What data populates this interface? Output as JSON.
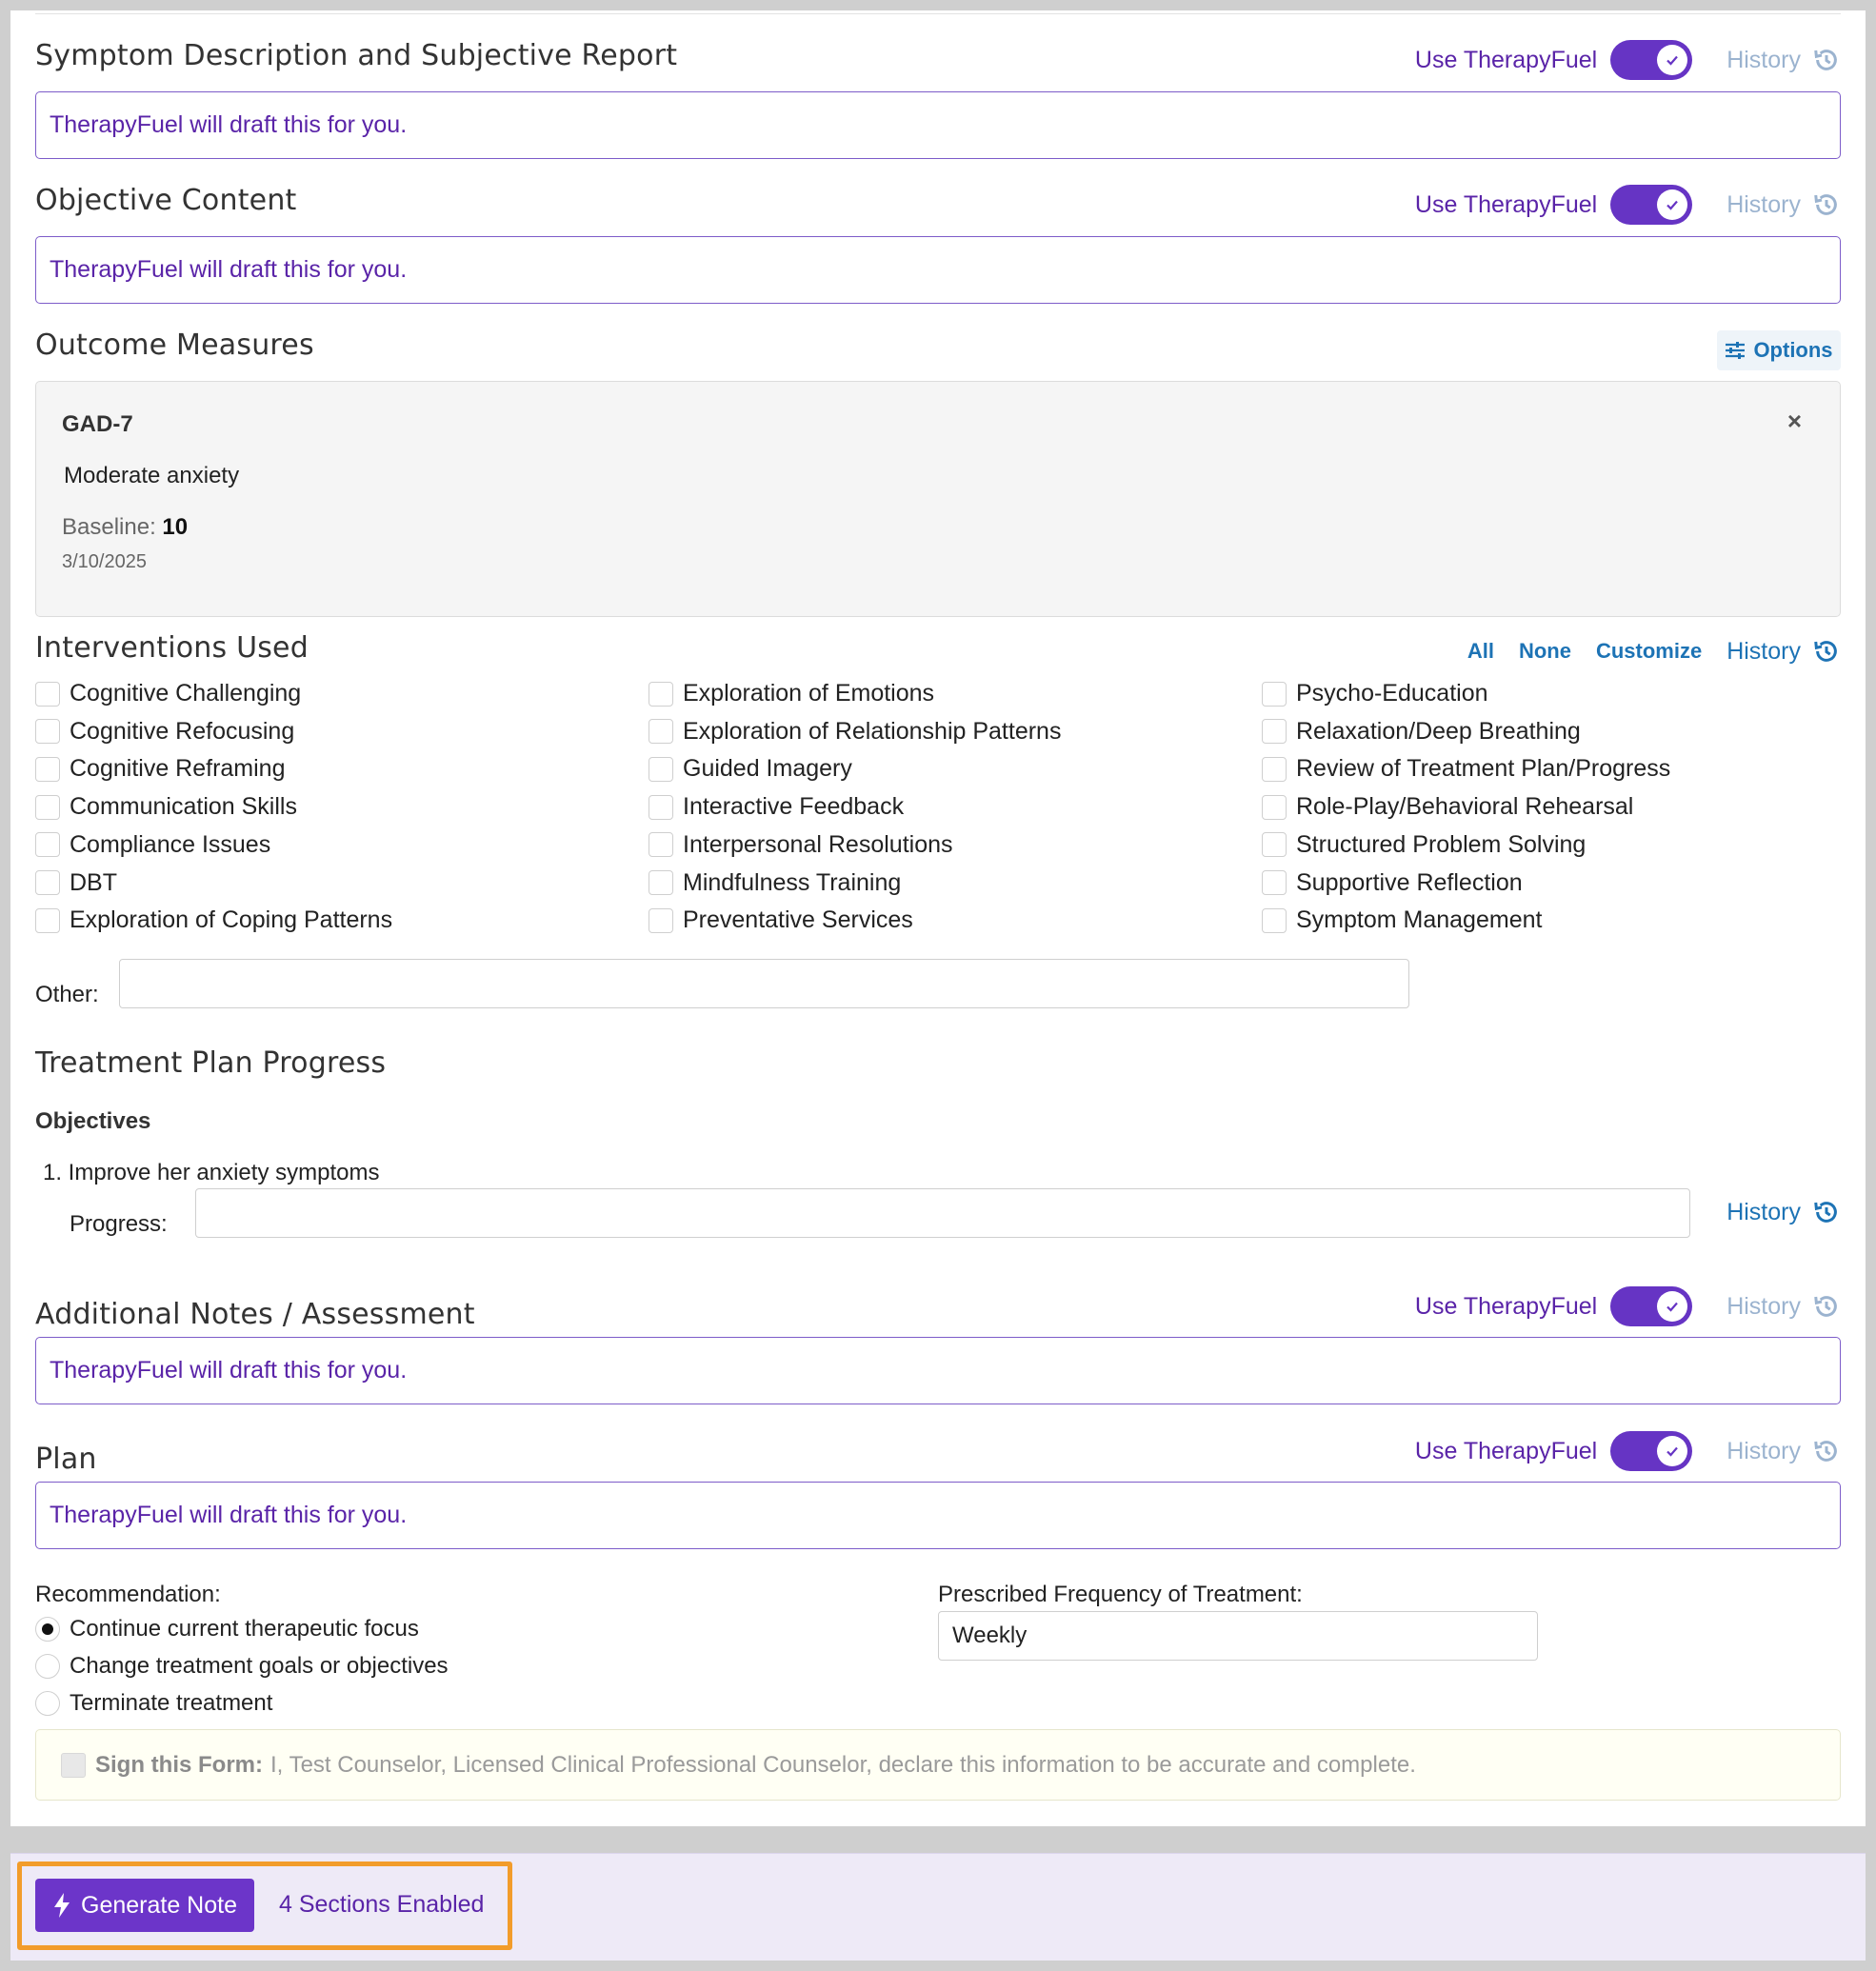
{
  "sections": {
    "symptom": {
      "title": "Symptom Description and Subjective Report",
      "use_label": "Use TherapyFuel",
      "history_label": "History",
      "placeholder": "TherapyFuel will draft this for you."
    },
    "objective": {
      "title": "Objective Content",
      "use_label": "Use TherapyFuel",
      "history_label": "History",
      "placeholder": "TherapyFuel will draft this for you."
    },
    "notes": {
      "title": "Additional Notes / Assessment",
      "use_label": "Use TherapyFuel",
      "history_label": "History",
      "placeholder": "TherapyFuel will draft this for you."
    },
    "plan": {
      "title": "Plan",
      "use_label": "Use TherapyFuel",
      "history_label": "History",
      "placeholder": "TherapyFuel will draft this for you."
    }
  },
  "outcome": {
    "title": "Outcome Measures",
    "options_label": "Options",
    "measure": {
      "name": "GAD-7",
      "description": "Moderate anxiety",
      "baseline_label": "Baseline:",
      "baseline_value": "10",
      "date": "3/10/2025",
      "close": "×"
    }
  },
  "interventions": {
    "title": "Interventions Used",
    "all_label": "All",
    "none_label": "None",
    "customize_label": "Customize",
    "history_label": "History",
    "col1": [
      "Cognitive Challenging",
      "Cognitive Refocusing",
      "Cognitive Reframing",
      "Communication Skills",
      "Compliance Issues",
      "DBT",
      "Exploration of Coping Patterns"
    ],
    "col2": [
      "Exploration of Emotions",
      "Exploration of Relationship Patterns",
      "Guided Imagery",
      "Interactive Feedback",
      "Interpersonal Resolutions",
      "Mindfulness Training",
      "Preventative Services"
    ],
    "col3": [
      "Psycho-Education",
      "Relaxation/Deep Breathing",
      "Review of Treatment Plan/Progress",
      "Role-Play/Behavioral Rehearsal",
      "Structured Problem Solving",
      "Supportive Reflection",
      "Symptom Management"
    ],
    "other_label": "Other:"
  },
  "treatment": {
    "title": "Treatment Plan Progress",
    "objectives_label": "Objectives",
    "objective_1": "1. Improve her anxiety symptoms",
    "progress_label": "Progress:",
    "history_label": "History"
  },
  "recommendation": {
    "label": "Recommendation:",
    "options": [
      "Continue current therapeutic focus",
      "Change treatment goals or objectives",
      "Terminate treatment"
    ],
    "frequency_label": "Prescribed Frequency of Treatment:",
    "frequency_value": "Weekly"
  },
  "sign": {
    "bold": "Sign this Form:",
    "text": "I, Test Counselor, Licensed Clinical Professional Counselor, declare this information to be accurate and complete."
  },
  "footer": {
    "generate_label": "Generate Note",
    "sections_enabled": "4 Sections Enabled"
  },
  "colors": {
    "accent": "#6634c4",
    "link": "#1d73b5",
    "highlight": "#f29c2b"
  }
}
